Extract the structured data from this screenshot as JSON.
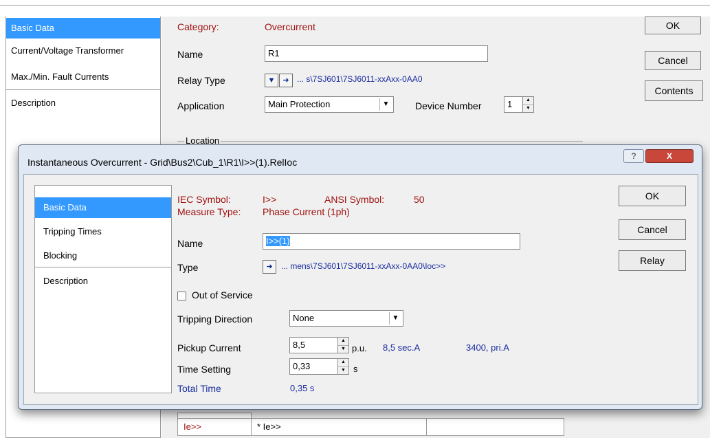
{
  "parent": {
    "sidebar": [
      {
        "label": "Basic Data",
        "active": true
      },
      {
        "label": "Current/Voltage Transformer",
        "active": false
      },
      {
        "label": "Max./Min. Fault Currents",
        "active": false
      },
      {
        "label": "Description",
        "active": false
      }
    ],
    "category_label": "Category:",
    "category_value": "Overcurrent",
    "name_label": "Name",
    "name_value": "R1",
    "relay_type_label": "Relay Type",
    "relay_type_path": "... s\\7SJ601\\7SJ6011-xxAxx-0AA0",
    "application_label": "Application",
    "application_value": "Main Protection",
    "device_number_label": "Device Number",
    "device_number_value": "1",
    "location_label": "Location",
    "buttons": {
      "ok": "OK",
      "cancel": "Cancel",
      "contents": "Contents"
    },
    "grid": {
      "cell1": "Ie>>",
      "cell2": "* Ie>>"
    }
  },
  "dialog": {
    "title": "Instantaneous Overcurrent - Grid\\Bus2\\Cub_1\\R1\\I>>(1).RelIoc",
    "help_icon": "question-icon",
    "close_icon": "close-x-icon",
    "sidebar": [
      {
        "label": "Basic Data",
        "active": true
      },
      {
        "label": "Tripping Times",
        "active": false
      },
      {
        "label": "Blocking",
        "active": false
      },
      {
        "label": "Description",
        "active": false
      }
    ],
    "iec_symbol_label": "IEC Symbol:",
    "iec_symbol_value": "I>>",
    "ansi_symbol_label": "ANSI Symbol:",
    "ansi_symbol_value": "50",
    "measure_type_label": "Measure Type:",
    "measure_type_value": "Phase Current (1ph)",
    "name_label": "Name",
    "name_value": "I>>(1)",
    "type_label": "Type",
    "type_path": "... mens\\7SJ601\\7SJ6011-xxAxx-0AA0\\Ioc>>",
    "out_of_service_label": "Out of Service",
    "out_of_service_checked": false,
    "tripping_direction_label": "Tripping Direction",
    "tripping_direction_value": "None",
    "pickup_current_label": "Pickup Current",
    "pickup_current_value": "8,5",
    "pickup_current_unit": "p.u.",
    "pickup_sec": "8,5 sec.A",
    "pickup_pri": "3400, pri.A",
    "time_setting_label": "Time Setting",
    "time_setting_value": "0,33",
    "time_setting_unit": "s",
    "total_time_label": "Total Time",
    "total_time_value": "0,35 s",
    "buttons": {
      "ok": "OK",
      "cancel": "Cancel",
      "relay": "Relay"
    }
  },
  "colors": {
    "accent": "#3399ff",
    "dark_red": "#a01010",
    "link_blue": "#1a2da0"
  }
}
